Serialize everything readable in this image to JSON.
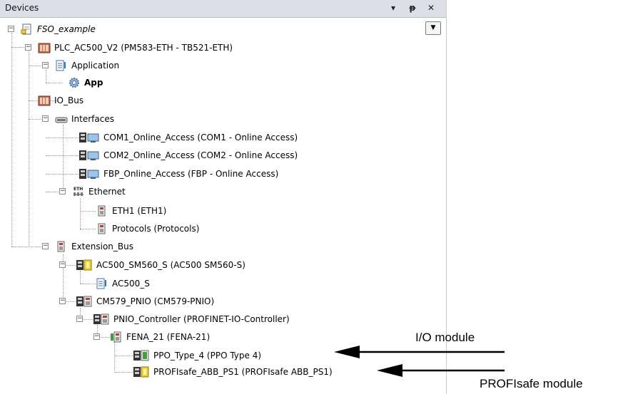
{
  "panel": {
    "title": "Devices",
    "pin_glyph": "▾",
    "dock_glyph": "⫟",
    "close_glyph": "✕",
    "dropdown_glyph": "▼"
  },
  "tree": {
    "fso_example": "FSO_example",
    "plc": "PLC_AC500_V2 (PM583-ETH - TB521-ETH)",
    "application": "Application",
    "app": "App",
    "io_bus": "IO_Bus",
    "interfaces": "Interfaces",
    "com1": "COM1_Online_Access (COM1 - Online Access)",
    "com2": "COM2_Online_Access (COM2 - Online Access)",
    "fbp": "FBP_Online_Access (FBP - Online Access)",
    "ethernet": "Ethernet",
    "eth1": "ETH1 (ETH1)",
    "protocols": "Protocols (Protocols)",
    "extension_bus": "Extension_Bus",
    "ac500_sm560": "AC500_SM560_S (AC500 SM560-S)",
    "ac500_s": "AC500_S",
    "cm579": "CM579_PNIO (CM579-PNIO)",
    "pnio_controller": "PNIO_Controller (PROFINET-IO-Controller)",
    "fena21": "FENA_21 (FENA-21)",
    "ppo_type4": "PPO_Type_4 (PPO Type 4)",
    "profisafe": "PROFIsafe_ABB_PS1 (PROFIsafe ABB_PS1)"
  },
  "annotations": {
    "io_module": "I/O module",
    "profisafe_module": "PROFIsafe module"
  },
  "colors": {
    "titlebar": "#dcdfe5",
    "device_red": "#b0413e",
    "folder_blue": "#3a6fb0",
    "yellow": "#f2d12e",
    "green": "#3f9e3f"
  }
}
